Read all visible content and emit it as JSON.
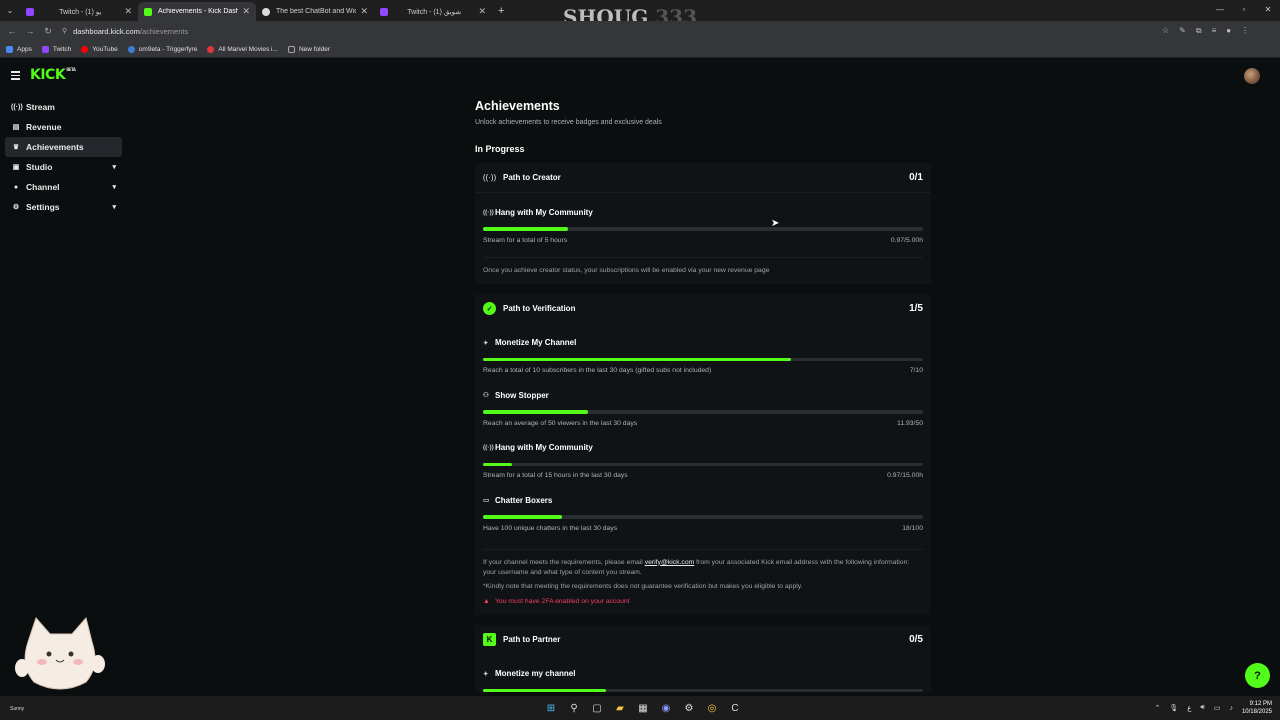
{
  "browser": {
    "tabs": [
      {
        "title": "Twitch - يو (1)",
        "fav": "#9146ff",
        "active": false
      },
      {
        "title": "Achievements - Kick Dashboard",
        "fav": "#53fc18",
        "active": true
      },
      {
        "title": "The best ChatBot and Widgets",
        "fav": "#dcdcdc",
        "active": false
      },
      {
        "title": "Twitch - (1) شويق",
        "fav": "#9146ff",
        "active": false
      }
    ],
    "watermark_text": "SHOUG",
    "watermark_num": "333",
    "url_host": "dashboard.kick.com",
    "url_path": "/achievements",
    "bookmarks": [
      {
        "label": "Apps",
        "color": "#4a8af4"
      },
      {
        "label": "Twitch",
        "color": "#9146ff"
      },
      {
        "label": "YouTube",
        "color": "#ff0000"
      },
      {
        "label": "om9eta - Triggerfyre",
        "color": "#3b7dd8"
      },
      {
        "label": "All Marvel Movies i...",
        "color": "#e23636"
      },
      {
        "label": "New folder",
        "color": "#555555"
      }
    ]
  },
  "sidebar": {
    "items": [
      {
        "label": "Stream",
        "icon": "broadcast-icon",
        "glyph": "((·))",
        "active": false,
        "chevron": false
      },
      {
        "label": "Revenue",
        "icon": "revenue-icon",
        "glyph": "▤",
        "active": false,
        "chevron": false
      },
      {
        "label": "Achievements",
        "icon": "trophy-icon",
        "glyph": "🏆︎",
        "active": true,
        "chevron": false
      },
      {
        "label": "Studio",
        "icon": "studio-icon",
        "glyph": "▣",
        "active": false,
        "chevron": true
      },
      {
        "label": "Channel",
        "icon": "channel-icon",
        "glyph": "●",
        "active": false,
        "chevron": true
      },
      {
        "label": "Settings",
        "icon": "gear-icon",
        "glyph": "⚙",
        "active": false,
        "chevron": true
      }
    ]
  },
  "page": {
    "title": "Achievements",
    "subtitle": "Unlock achievements to receive badges and exclusive deals",
    "section": "In Progress"
  },
  "creator": {
    "name": "Path to Creator",
    "score": "0/1",
    "items": [
      {
        "name": "Hang with My Community",
        "icon": "broadcast-icon",
        "desc": "Stream for a total of 5 hours",
        "value": "0.97/5.00h",
        "progress": 0.194
      }
    ],
    "note": "Once you achieve creator status, your subscriptions will be enabled via your new revenue page"
  },
  "verification": {
    "name": "Path to Verification",
    "score": "1/5",
    "items": [
      {
        "name": "Monetize My Channel",
        "icon": "sparkle-icon",
        "desc": "Reach a total of 10 subscribers in the last 30 days (gifted subs not included)",
        "value": "7/10",
        "progress": 0.7
      },
      {
        "name": "Show Stopper",
        "icon": "users-icon",
        "desc": "Reach an average of 50 viewers in the last 30 days",
        "value": "11.93/50",
        "progress": 0.239
      },
      {
        "name": "Hang with My Community",
        "icon": "broadcast-icon",
        "desc": "Stream for a total of 15 hours in the last 30 days",
        "value": "0.97/15.00h",
        "progress": 0.065
      },
      {
        "name": "Chatter Boxers",
        "icon": "chat-icon",
        "desc": "Have 100 unique chatters in the last 30 days",
        "value": "18/100",
        "progress": 0.18
      }
    ],
    "note_pre": "If your channel meets the requirements, please email",
    "note_link": "verify@kick.com",
    "note_post": "from your associated Kick email address with the following information: your username and what type of content you stream.",
    "note2": "*Kindly note that meeting the requirements does not guarantee verification but makes you eligible to apply.",
    "warning": "You must have 2FA enabled on your account"
  },
  "partner": {
    "name": "Path to Partner",
    "score": "0/5",
    "items": [
      {
        "name": "Monetize my channel",
        "icon": "sparkle-icon",
        "progress": 0.28
      }
    ]
  },
  "taskbar": {
    "time": "9:12 PM",
    "date": "10/18/2025",
    "lang": "ع",
    "weather": "Sunny"
  }
}
